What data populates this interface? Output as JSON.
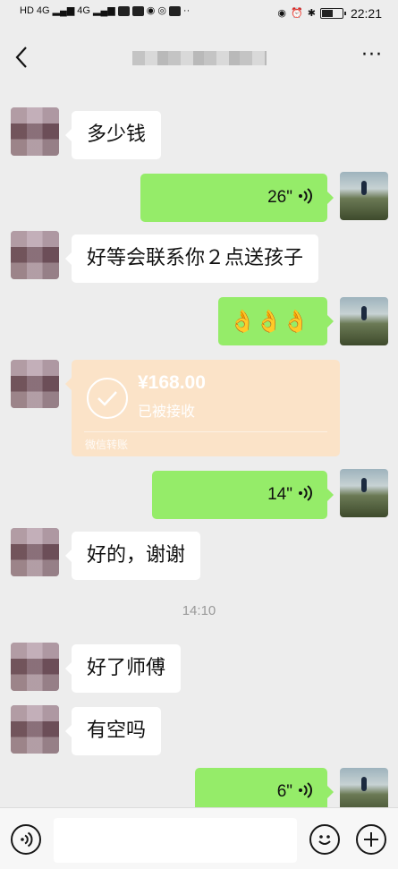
{
  "status_bar": {
    "network_labels": [
      "HD",
      "4G",
      "4G"
    ],
    "time": "22:21",
    "battery_level": 0.55
  },
  "nav": {
    "more_label": "···"
  },
  "messages": [
    {
      "side": "in",
      "text": "多少钱"
    },
    {
      "side": "out",
      "type": "voice",
      "duration": "26\""
    },
    {
      "side": "in",
      "text": "好等会联系你２点送孩子"
    },
    {
      "side": "out",
      "type": "emoji",
      "text": "👌👌👌"
    },
    {
      "side": "in",
      "type": "transfer",
      "amount": "¥168.00",
      "status": "已被接收",
      "footer": "微信转账"
    },
    {
      "side": "out",
      "type": "voice",
      "duration": "14\""
    },
    {
      "side": "in",
      "text": "好的，谢谢"
    },
    {
      "type": "timestamp",
      "text": "14:10"
    },
    {
      "side": "in",
      "text": "好了师傅"
    },
    {
      "side": "in",
      "text": "有空吗"
    },
    {
      "side": "out",
      "type": "voice",
      "duration": "6\""
    }
  ],
  "colors": {
    "background": "#ededed",
    "bubble_out": "#95ec69",
    "bubble_in": "#ffffff",
    "transfer": "#fbe3c8"
  },
  "icons": {
    "back": "chevron-left-icon",
    "more": "more-dots-icon",
    "voice_mode": "voice-input-icon",
    "emoji": "emoji-icon",
    "plus": "plus-icon"
  },
  "input": {
    "value": "",
    "placeholder": ""
  }
}
